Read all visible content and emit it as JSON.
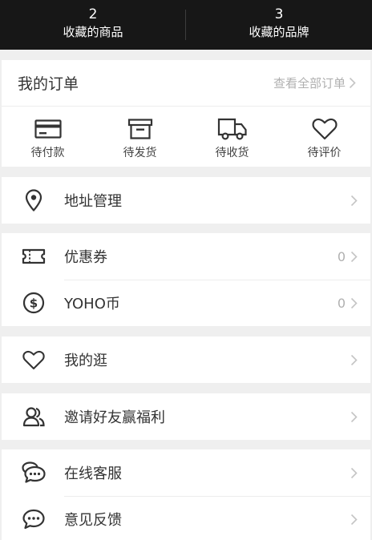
{
  "stats": {
    "favorites_goods": {
      "count": "2",
      "label": "收藏的商品"
    },
    "favorites_brands": {
      "count": "3",
      "label": "收藏的品牌"
    }
  },
  "orders": {
    "title": "我的订单",
    "view_all": "查看全部订单",
    "statuses": [
      {
        "label": "待付款",
        "icon": "card-icon"
      },
      {
        "label": "待发货",
        "icon": "box-icon"
      },
      {
        "label": "待收货",
        "icon": "truck-icon"
      },
      {
        "label": "待评价",
        "icon": "heart-icon"
      }
    ]
  },
  "menu": {
    "address": {
      "label": "地址管理",
      "icon": "location-pin-icon"
    },
    "coupons": {
      "label": "优惠券",
      "value": "0",
      "icon": "ticket-icon"
    },
    "yoho_coin": {
      "label": "YOHO币",
      "value": "0",
      "icon": "dollar-coin-icon"
    },
    "my_browse": {
      "label": "我的逛",
      "icon": "heart-icon"
    },
    "invite": {
      "label": "邀请好友赢福利",
      "icon": "users-icon"
    },
    "online_service": {
      "label": "在线客服",
      "icon": "chat-bubbles-icon"
    },
    "feedback": {
      "label": "意见反馈",
      "icon": "chat-dots-icon"
    }
  },
  "colors": {
    "header_bg": "#171717",
    "page_bg": "#efefef",
    "icon": "#333333",
    "muted_text": "#b0b0b0"
  }
}
